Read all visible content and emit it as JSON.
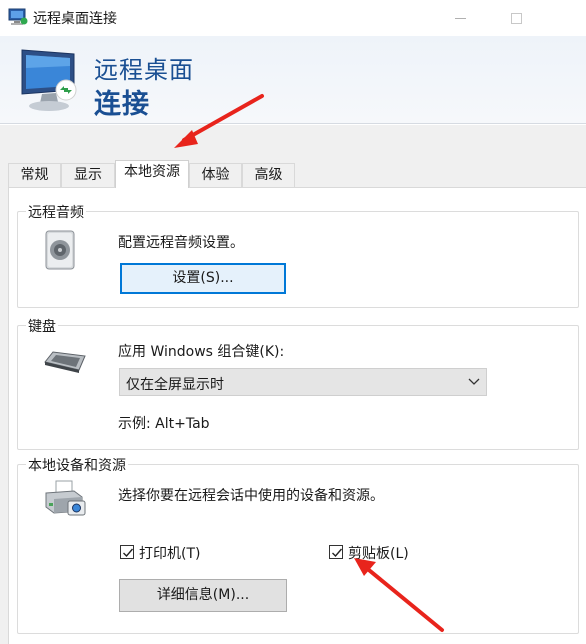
{
  "window": {
    "title": "远程桌面连接",
    "banner_line1": "远程桌面",
    "banner_line2": "连接"
  },
  "tabs": [
    {
      "label": "常规",
      "active": false
    },
    {
      "label": "显示",
      "active": false
    },
    {
      "label": "本地资源",
      "active": true
    },
    {
      "label": "体验",
      "active": false
    },
    {
      "label": "高级",
      "active": false
    }
  ],
  "audio": {
    "group_title": "远程音频",
    "description": "配置远程音频设置。",
    "settings_button": "设置(S)..."
  },
  "keyboard": {
    "group_title": "键盘",
    "label": "应用 Windows 组合键(K):",
    "selected_value": "仅在全屏显示时",
    "example": "示例: Alt+Tab"
  },
  "devices": {
    "group_title": "本地设备和资源",
    "description": "选择你要在远程会话中使用的设备和资源。",
    "printer_label": "打印机(T)",
    "printer_checked": true,
    "clipboard_label": "剪贴板(L)",
    "clipboard_checked": true,
    "details_button": "详细信息(M)..."
  },
  "colors": {
    "accent": "#0078d7",
    "banner_text": "#1a4f93",
    "annotation_arrow": "#e8241c"
  }
}
